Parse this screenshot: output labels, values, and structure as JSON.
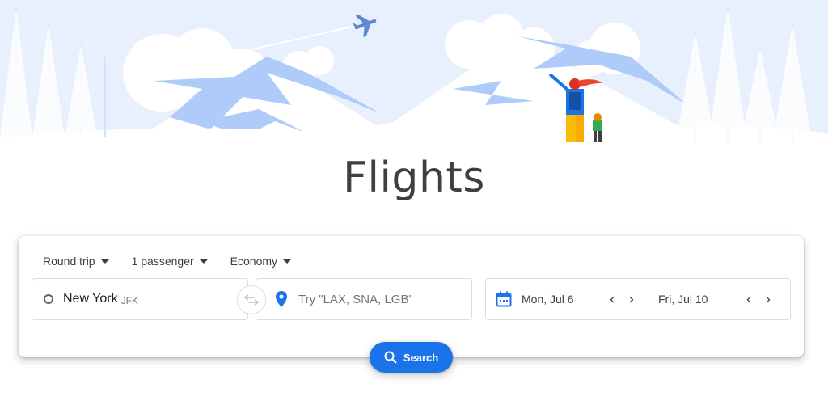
{
  "page": {
    "title": "Flights"
  },
  "options": {
    "trip_type": "Round trip",
    "passengers": "1 passenger",
    "cabin_class": "Economy"
  },
  "origin": {
    "city": "New York",
    "code": "JFK"
  },
  "destination": {
    "placeholder": "Try \"LAX, SNA, LGB\""
  },
  "dates": {
    "depart": "Mon, Jul 6",
    "return": "Fri, Jul 10"
  },
  "search": {
    "label": "Search"
  },
  "colors": {
    "accent": "#1a73e8",
    "illustration_blue": "#aecbfa",
    "sky": "#e8f0fe"
  },
  "icons": [
    "airplane-icon",
    "circle-icon",
    "swap-icon",
    "location-pin-icon",
    "calendar-icon",
    "chevron-left-icon",
    "chevron-right-icon",
    "search-icon",
    "caret-down-icon"
  ]
}
